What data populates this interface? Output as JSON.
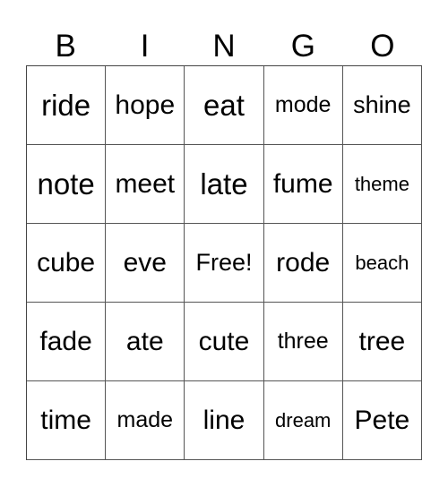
{
  "header": [
    "B",
    "I",
    "N",
    "G",
    "O"
  ],
  "cells": [
    [
      "ride",
      "hope",
      "eat",
      "mode",
      "shine"
    ],
    [
      "note",
      "meet",
      "late",
      "fume",
      "theme"
    ],
    [
      "cube",
      "eve",
      "Free!",
      "rode",
      "beach"
    ],
    [
      "fade",
      "ate",
      "cute",
      "three",
      "tree"
    ],
    [
      "time",
      "made",
      "line",
      "dream",
      "Pete"
    ]
  ]
}
